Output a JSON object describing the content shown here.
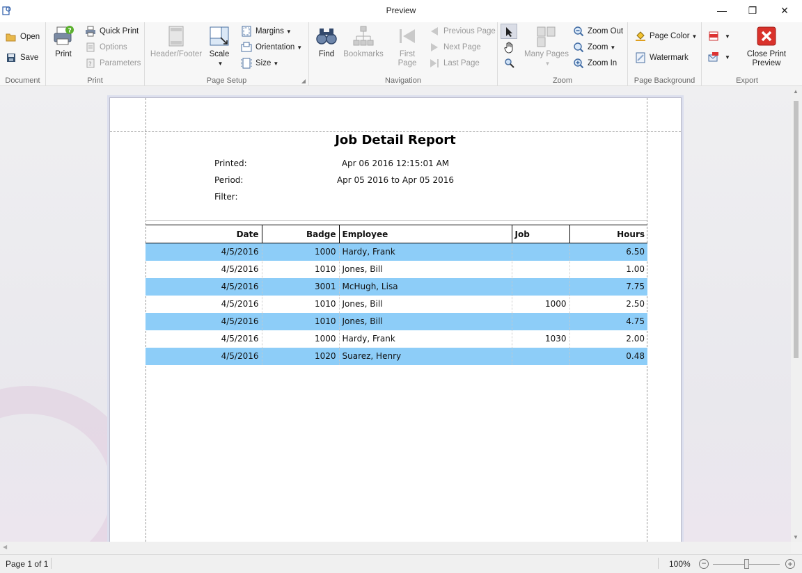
{
  "window": {
    "title": "Preview",
    "minimize_glyph": "—",
    "restore_glyph": "❐",
    "close_glyph": "✕"
  },
  "ribbon": {
    "document": {
      "label": "Document",
      "open": "Open",
      "save": "Save"
    },
    "print": {
      "label": "Print",
      "print": "Print",
      "quick_print": "Quick Print",
      "options": "Options",
      "parameters": "Parameters"
    },
    "page_setup": {
      "label": "Page Setup",
      "header_footer": "Header/Footer",
      "scale": "Scale",
      "margins": "Margins",
      "orientation": "Orientation",
      "size": "Size"
    },
    "navigation": {
      "label": "Navigation",
      "find": "Find",
      "bookmarks": "Bookmarks",
      "first_page_1": "First",
      "first_page_2": "Page",
      "previous_page": "Previous Page",
      "next_page": "Next Page",
      "last_page": "Last Page"
    },
    "zoom": {
      "label": "Zoom",
      "many_pages": "Many Pages",
      "zoom_out": "Zoom Out",
      "zoom": "Zoom",
      "zoom_in": "Zoom In"
    },
    "page_background": {
      "label": "Page Background",
      "page_color": "Page Color",
      "watermark": "Watermark"
    },
    "export": {
      "label": "Export",
      "close_preview_1": "Close Print",
      "close_preview_2": "Preview"
    }
  },
  "report": {
    "title": "Job Detail Report",
    "printed_label": "Printed:",
    "printed_value": "Apr 06 2016 12:15:01 AM",
    "period_label": "Period:",
    "period_value": "Apr 05 2016 to Apr 05 2016",
    "filter_label": "Filter:",
    "columns": [
      "Date",
      "Badge",
      "Employee",
      "Job",
      "Hours"
    ],
    "rows": [
      [
        "4/5/2016",
        "1000",
        "Hardy, Frank",
        "",
        "6.50"
      ],
      [
        "4/5/2016",
        "1010",
        "Jones, Bill",
        "",
        "1.00"
      ],
      [
        "4/5/2016",
        "3001",
        "McHugh, Lisa",
        "",
        "7.75"
      ],
      [
        "4/5/2016",
        "1010",
        "Jones, Bill",
        "1000",
        "2.50"
      ],
      [
        "4/5/2016",
        "1010",
        "Jones, Bill",
        "",
        "4.75"
      ],
      [
        "4/5/2016",
        "1000",
        "Hardy, Frank",
        "1030",
        "2.00"
      ],
      [
        "4/5/2016",
        "1020",
        "Suarez, Henry",
        "",
        "0.48"
      ]
    ],
    "highlight_color": "#8dcdf8"
  },
  "status": {
    "page_info": "Page 1 of 1",
    "zoom_level": "100%",
    "zoom_fraction": 0.5
  }
}
